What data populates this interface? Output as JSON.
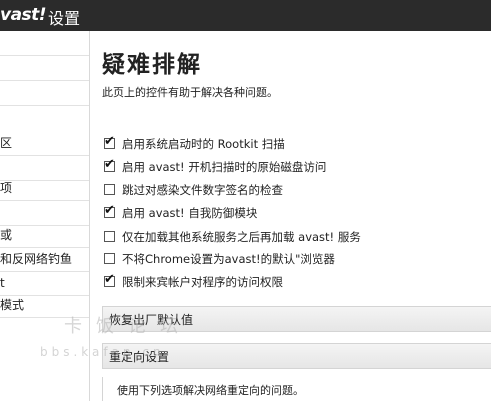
{
  "app": {
    "logo": "vast!",
    "title": "设置"
  },
  "sidebar": {
    "items": [
      {
        "label": ""
      },
      {
        "label": ""
      },
      {
        "label": "区"
      },
      {
        "label": ""
      },
      {
        "label": "项"
      },
      {
        "label": ""
      },
      {
        "label": "或"
      },
      {
        "label": "和反网络钓鱼"
      },
      {
        "label": "t"
      },
      {
        "label": "模式"
      }
    ]
  },
  "page": {
    "title": "疑难排解",
    "description": "此页上的控件有助于解决各种问题。"
  },
  "options": [
    {
      "label": "启用系统启动时的 Rootkit 扫描",
      "checked": true
    },
    {
      "label": "启用 avast! 开机扫描时的原始磁盘访问",
      "checked": true
    },
    {
      "label": "跳过对感染文件数字签名的检查",
      "checked": false
    },
    {
      "label": "启用 avast! 自我防御模块",
      "checked": true
    },
    {
      "label": "仅在加载其他系统服务之后再加载 avast! 服务",
      "checked": false
    },
    {
      "label": "不将Chrome设置为avast!的默认\"浏览器",
      "checked": false
    },
    {
      "label": "限制来宾帐户对程序的访问权限",
      "checked": true
    }
  ],
  "sections": {
    "restore_defaults": "恢复出厂默认值",
    "redirect_settings": "重定向设置",
    "redirect_desc": "使用下列选项解决网络重定向的问题。"
  },
  "watermark": {
    "text": "卡饭论坛",
    "url": "bbs.kafan.cn"
  }
}
